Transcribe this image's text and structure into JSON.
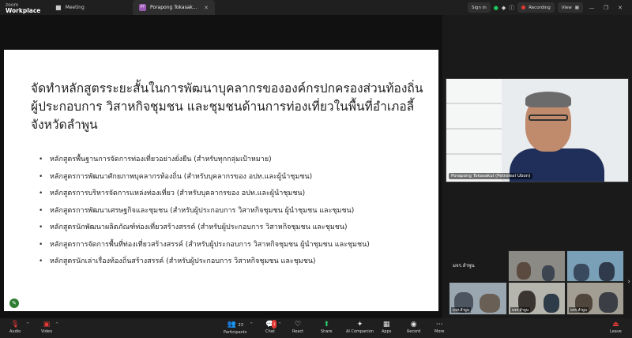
{
  "app": {
    "brand_line1": "zoom",
    "brand_line2": "Workplace"
  },
  "tabs": [
    {
      "label": "Meeting",
      "icon": "camera-icon"
    },
    {
      "label": "Porapong Tokasakul (Petroleal Ubon)",
      "initials": "PT",
      "icon": "close-icon"
    }
  ],
  "topbar": {
    "sign_in": "Sign in",
    "recording": "Recording",
    "view": "View",
    "accent_security": "#22c55e",
    "accent_record": "#e53935"
  },
  "slide": {
    "title": "จัดทำหลักสูตรระยะสั้นในการพัฒนาบุคลากรขององค์กรปกครองส่วนท้องถิ่น ผู้ประกอบการ วิสาหกิจชุมชน และชุมชนด้านการท่องเที่ยวในพื้นที่อำเภอลี้ จังหวัดลำพูน",
    "bullets": [
      "หลักสูตรพื้นฐานการจัดการท่องเที่ยวอย่างยั่งยืน (สำหรับทุกกลุ่มเป้าหมาย)",
      "หลักสูตรการพัฒนาศักยภาพบุคลากรท้องถิ่น (สำหรับบุคลากรของ อปท.และผู้นำชุมชน)",
      "หลักสูตรการบริหารจัดการแหล่งท่องเที่ยว (สำหรับบุคลากรของ อปท.และผู้นำชุมชน)",
      "หลักสูตรการพัฒนาเศรษฐกิจและชุมชน (สำหรับผู้ประกอบการ วิสาหกิจชุมชน ผู้นำชุมชน และชุมชน)",
      "หลักสูตรนักพัฒนาผลิตภัณฑ์ท่องเที่ยวสร้างสรรค์ (สำหรับผู้ประกอบการ วิสาหกิจชุมชน และชุมชน)",
      "หลักสูตรการจัดการพื้นที่ท่องเที่ยวสร้างสรรค์ (สำหรับผู้ประกอบการ วิสาหกิจชุมชน ผู้นำชุมชน และชุมชน)",
      "หลักสูตรนักเล่าเรื่องท้องถิ่นสร้างสรรค์ (สำหรับผู้ประกอบการ วิสาหกิจชุมชน และชุมชน)"
    ]
  },
  "speaker": {
    "name": "Porapong Tokasakul (Petroleal Ubon)"
  },
  "gallery": {
    "label": "มจร.ลำพูน",
    "tiles": [
      {
        "name": "มจร.ลำพูน"
      },
      {
        "name": "มจร.ลำพูน"
      },
      {
        "name": "มจร.ลำพูน"
      },
      {
        "name": "มจร.ลำพูน"
      },
      {
        "name": "มจร.ลำพูน"
      }
    ]
  },
  "toolbar": {
    "audio": "Audio",
    "video": "Video",
    "participants": "Participants",
    "participants_count": "23",
    "chat": "Chat",
    "chat_badge": "1",
    "react": "React",
    "share": "Share",
    "ai_companion": "AI Companion",
    "apps": "Apps",
    "record": "Record",
    "more": "More",
    "leave": "Leave"
  }
}
